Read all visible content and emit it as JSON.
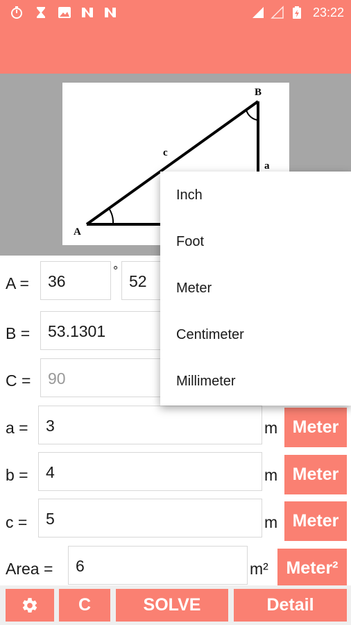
{
  "status_bar": {
    "time": "23:22",
    "icons": [
      "stopwatch-icon",
      "hourglass-icon",
      "image-icon",
      "n-icon",
      "n-icon",
      "signal-icon",
      "signal-empty-icon",
      "battery-icon"
    ]
  },
  "diagram": {
    "vertex_a": "A",
    "vertex_b": "B",
    "side_a": "a",
    "side_c": "c"
  },
  "angles": {
    "A_label": "A =",
    "A_degrees": "36",
    "degree_symbol": "°",
    "A_minutes": "52",
    "B_label": "B =",
    "B_value": "53.1301",
    "C_label": "C =",
    "C_value": "90"
  },
  "sides": [
    {
      "label": "a =",
      "value": "3",
      "unit": "m",
      "unit_button": "Meter"
    },
    {
      "label": "b =",
      "value": "4",
      "unit": "m",
      "unit_button": "Meter"
    },
    {
      "label": "c =",
      "value": "5",
      "unit": "m",
      "unit_button": "Meter"
    }
  ],
  "area": {
    "label": "Area =",
    "value": "6",
    "unit": "m²",
    "unit_button": "Meter²"
  },
  "bottom": {
    "clear_label": "C",
    "solve_label": "SOLVE",
    "detail_label": "Detail"
  },
  "dropdown": {
    "options": [
      "Inch",
      "Foot",
      "Meter",
      "Centimeter",
      "Millimeter"
    ]
  },
  "colors": {
    "accent": "#fa8072",
    "backdrop": "#a6a6a6"
  }
}
